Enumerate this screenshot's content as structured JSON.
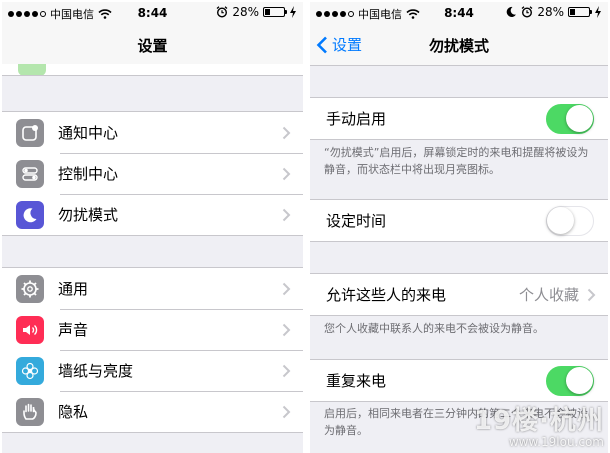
{
  "status_bar": {
    "carrier": "中国电信",
    "time": "8:44",
    "battery_percent": "28%",
    "battery_level": 0.28
  },
  "left_screen": {
    "nav_title": "设置",
    "groups": [
      {
        "items": [
          {
            "label": "通知中心",
            "icon": "notification-center-icon",
            "color": "#8e8e93"
          },
          {
            "label": "控制中心",
            "icon": "control-center-icon",
            "color": "#8e8e93"
          },
          {
            "label": "勿扰模式",
            "icon": "moon-icon",
            "color": "#5856d6"
          }
        ]
      },
      {
        "items": [
          {
            "label": "通用",
            "icon": "gear-icon",
            "color": "#8e8e93"
          },
          {
            "label": "声音",
            "icon": "speaker-icon",
            "color": "#ff2d55"
          },
          {
            "label": "墙纸与亮度",
            "icon": "flower-icon",
            "color": "#34aadc"
          },
          {
            "label": "隐私",
            "icon": "hand-icon",
            "color": "#8e8e93"
          }
        ]
      }
    ]
  },
  "right_screen": {
    "back_label": "设置",
    "nav_title": "勿扰模式",
    "manual": {
      "label": "手动启用",
      "on": true
    },
    "manual_note": "“勿扰模式”启用后，屏幕锁定时的来电和提醒将被设为静音，而状态栏中将出现月亮图标。",
    "scheduled": {
      "label": "设定时间",
      "on": false
    },
    "allow_calls": {
      "label": "允许这些人的来电",
      "value": "个人收藏"
    },
    "allow_note": "您个人收藏中联系人的来电不会被设为静音。",
    "repeated": {
      "label": "重复来电",
      "on": true
    },
    "repeated_note": "启用后，相同来电者在三分钟内的第二个来电不会被设为静音。"
  },
  "watermark": {
    "text": "19楼·杭州",
    "url": "www.19lou.com"
  },
  "colors": {
    "accent": "#007aff",
    "toggle_on": "#4cd964",
    "background": "#efeff4",
    "separator": "#c8c7cc"
  }
}
